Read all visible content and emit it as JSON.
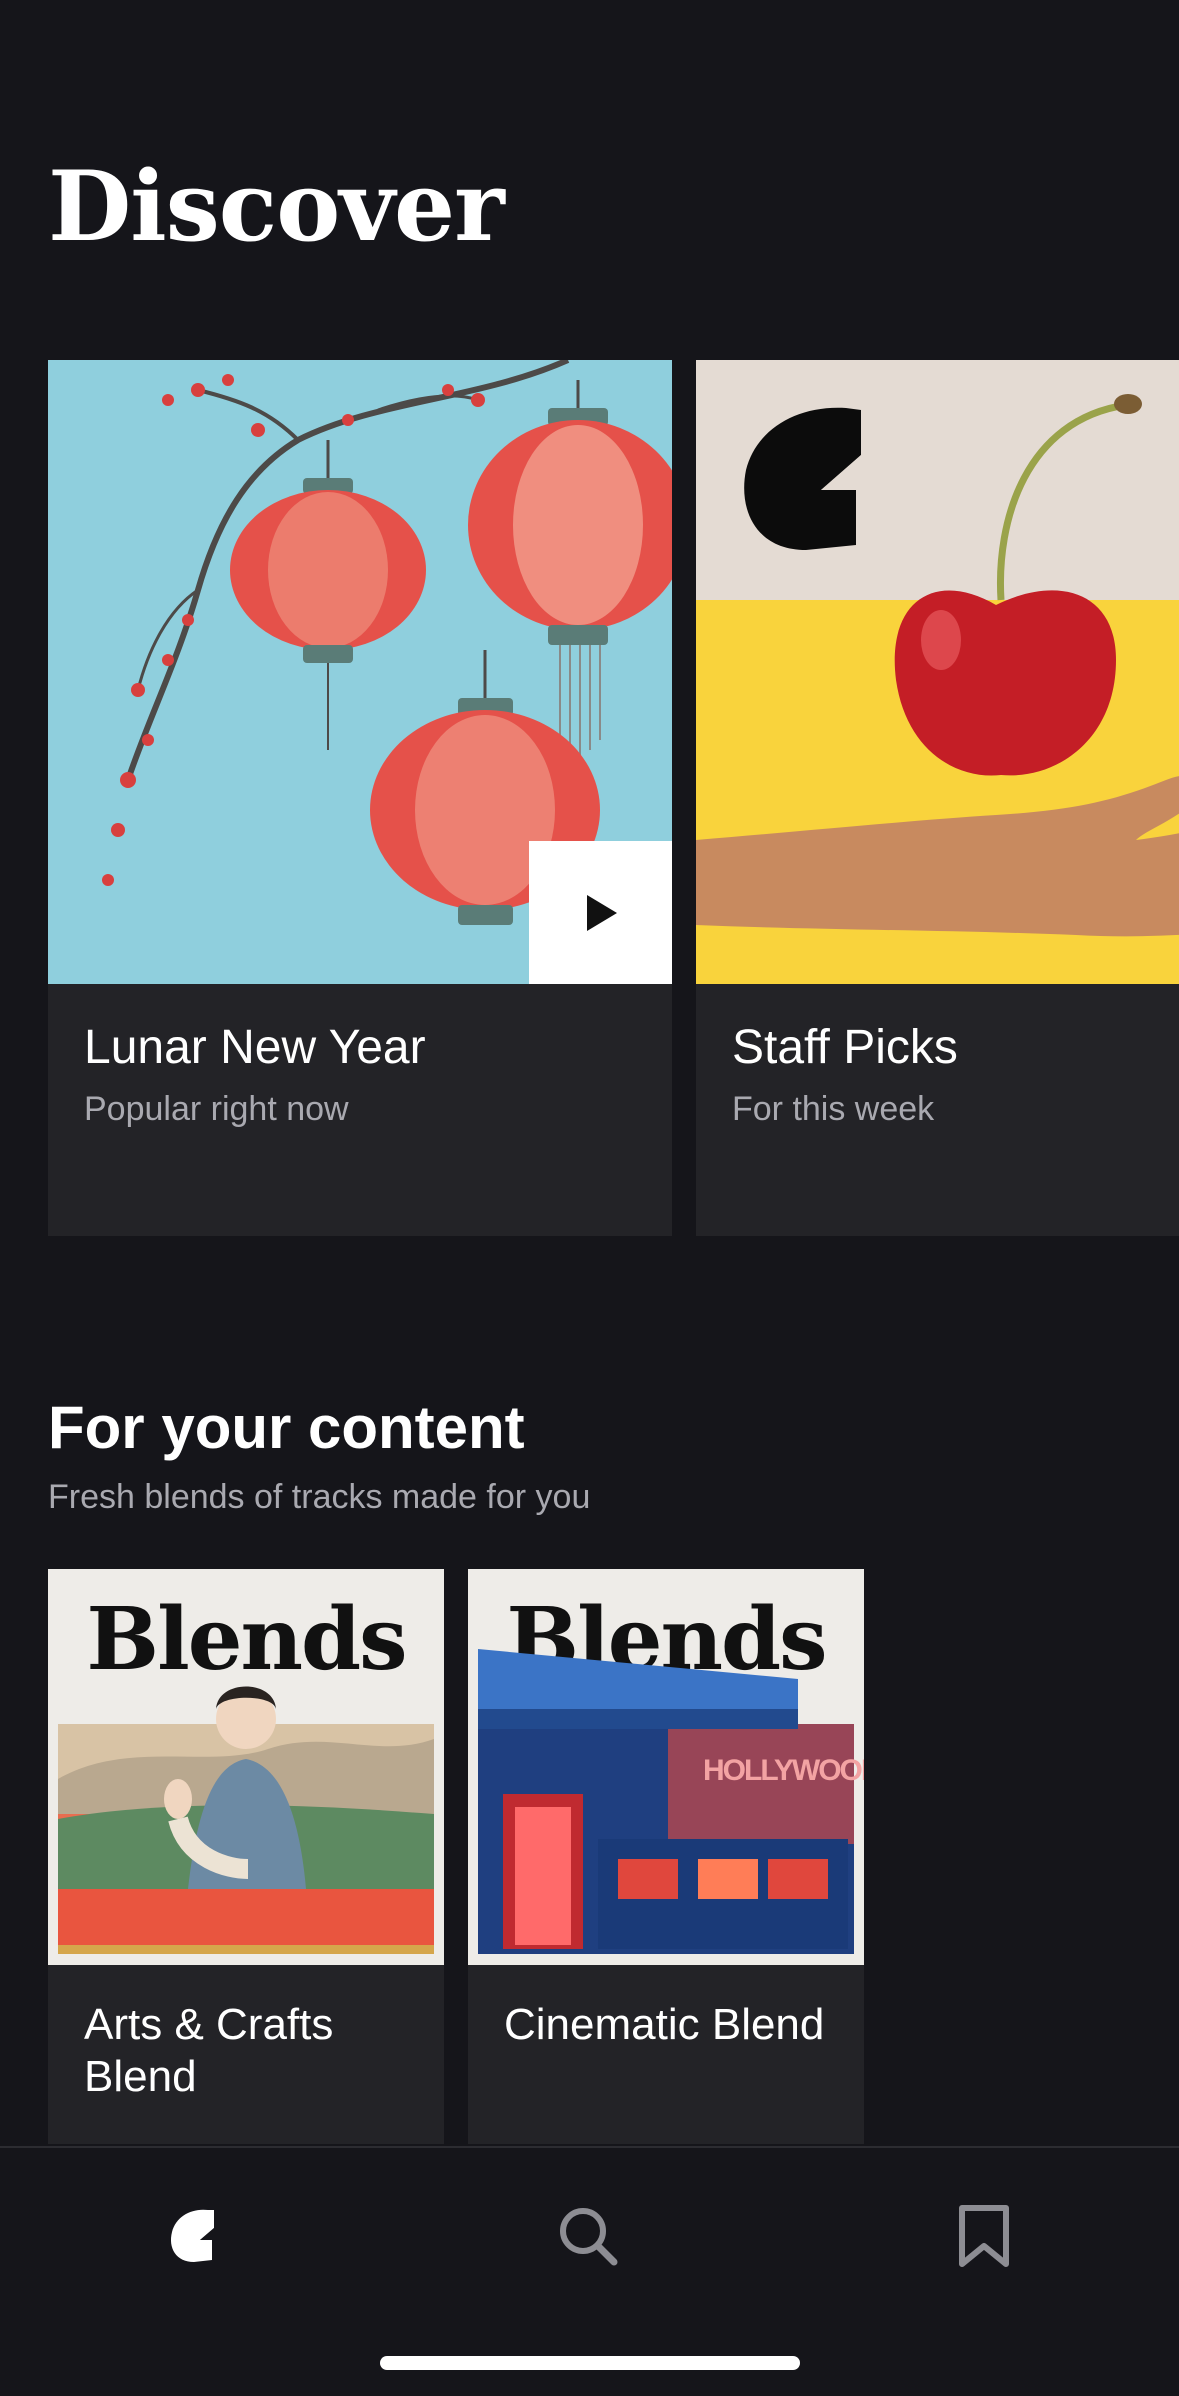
{
  "header": {
    "title": "Discover"
  },
  "featured": [
    {
      "title": "Lunar New Year",
      "subtitle": "Popular right now"
    },
    {
      "title": "Staff Picks",
      "subtitle": "For this week"
    }
  ],
  "section": {
    "title": "For your content",
    "subtitle": "Fresh blends of tracks made for you",
    "blends": [
      {
        "art_word": "Blends",
        "title": "Arts & Crafts Blend"
      },
      {
        "art_word": "Blends",
        "title": "Cinematic Blend",
        "sign_text": "HOLLYWOOD"
      }
    ]
  },
  "tab_bar": {
    "items": [
      "home-icon",
      "search-icon",
      "bookmark-icon"
    ],
    "active": "home-icon"
  },
  "colors": {
    "background": "#15151a",
    "card": "#232327",
    "muted_text": "#a9a9b0",
    "accent_yellow": "#f9d33c",
    "sky_blue": "#8fcfdd"
  }
}
